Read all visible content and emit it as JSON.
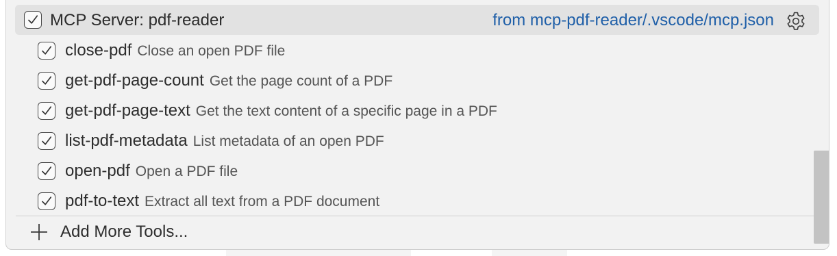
{
  "server": {
    "label": "MCP Server: pdf-reader",
    "source": "from mcp-pdf-reader/.vscode/mcp.json",
    "checked": true,
    "settings_icon": "gear-icon"
  },
  "tools": [
    {
      "name": "close-pdf",
      "description": "Close an open PDF file",
      "checked": true
    },
    {
      "name": "get-pdf-page-count",
      "description": "Get the page count of a PDF",
      "checked": true
    },
    {
      "name": "get-pdf-page-text",
      "description": "Get the text content of a specific page in a PDF",
      "checked": true
    },
    {
      "name": "list-pdf-metadata",
      "description": "List metadata of an open PDF",
      "checked": true
    },
    {
      "name": "open-pdf",
      "description": "Open a PDF file",
      "checked": true
    },
    {
      "name": "pdf-to-text",
      "description": "Extract all text from a PDF document",
      "checked": true
    }
  ],
  "footer": {
    "add_label": "Add More Tools...",
    "add_icon": "plus-icon"
  },
  "colors": {
    "link": "#1f5fa8",
    "panel_bg": "#f2f2f2",
    "selected_row_bg": "#e2e2e2"
  }
}
